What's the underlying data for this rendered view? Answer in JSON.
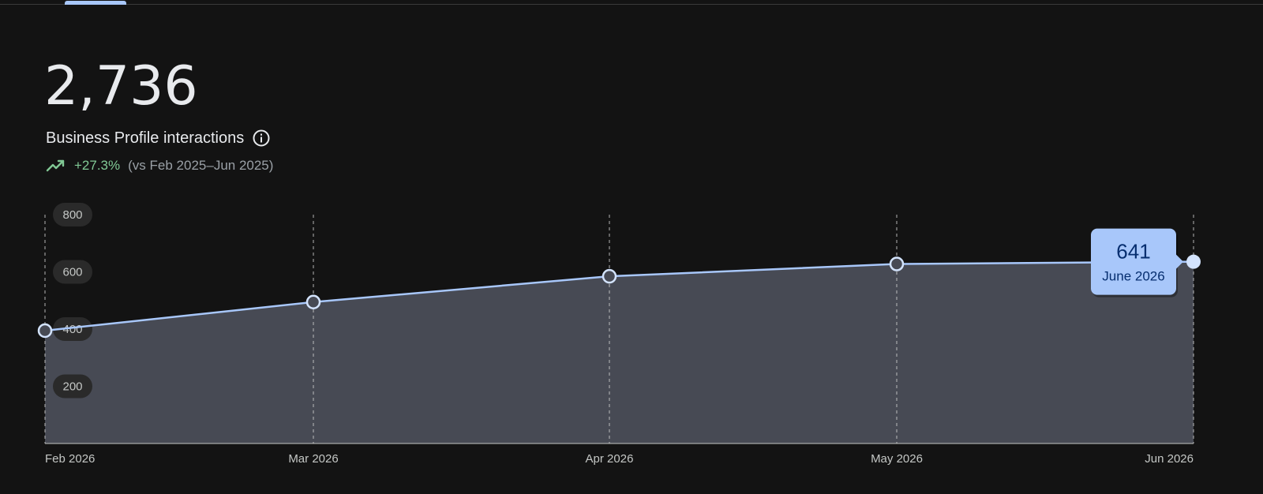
{
  "header": {
    "total_value": "2,736",
    "metric_title": "Business Profile interactions",
    "info_icon": "info-icon",
    "trend_icon": "trending-up-icon",
    "trend_percent": "+27.3%",
    "trend_comparison": "(vs Feb 2025–Jun 2025)"
  },
  "colors": {
    "background": "#131313",
    "line": "#a8c7fa",
    "area": "#474a54",
    "trend_positive": "#81c995",
    "tooltip_bg": "#a8c7fa",
    "tooltip_text": "#062e6f"
  },
  "chart_data": {
    "type": "area",
    "categories": [
      "Feb 2026",
      "Mar 2026",
      "Apr 2026",
      "May 2026",
      "Jun 2026"
    ],
    "values": [
      400,
      500,
      590,
      633,
      641
    ],
    "y_ticks": [
      200,
      400,
      600,
      800
    ],
    "ylim": [
      0,
      800
    ],
    "grid": "vertical dashed",
    "tooltip": {
      "value": "641",
      "label": "June 2026",
      "category_index": 4
    }
  }
}
